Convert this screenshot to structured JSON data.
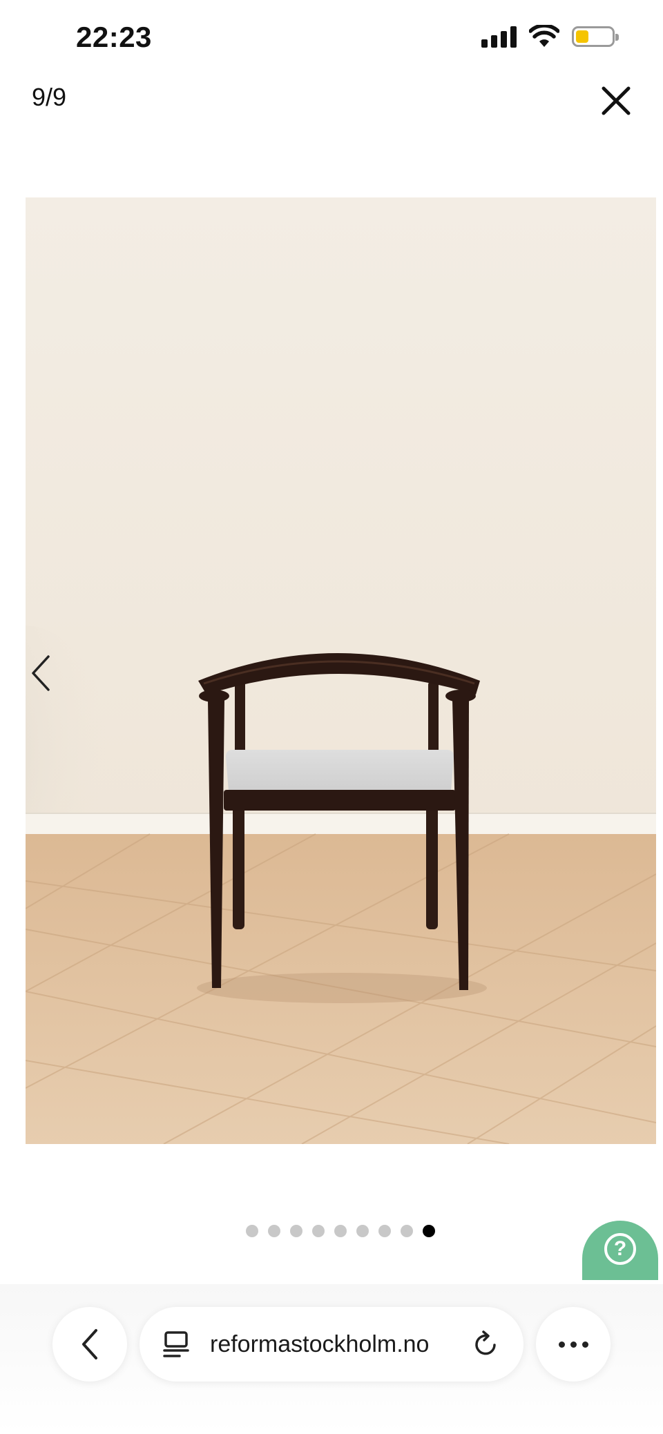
{
  "status_bar": {
    "time": "22:23",
    "battery_level": 0.35,
    "battery_color": "#f5c400"
  },
  "viewer": {
    "counter": "9/9",
    "close_icon": "close-icon",
    "prev_icon": "chevron-left-icon",
    "image_subject": "chair-photo",
    "total_images": 9,
    "current_index": 9
  },
  "help": {
    "label": "?",
    "color": "#6cbf94"
  },
  "browser": {
    "url": "reformastockholm.no",
    "back_icon": "chevron-left-icon",
    "tabs_icon": "page-icon",
    "reload_icon": "reload-icon",
    "more_icon": "more-icon"
  }
}
